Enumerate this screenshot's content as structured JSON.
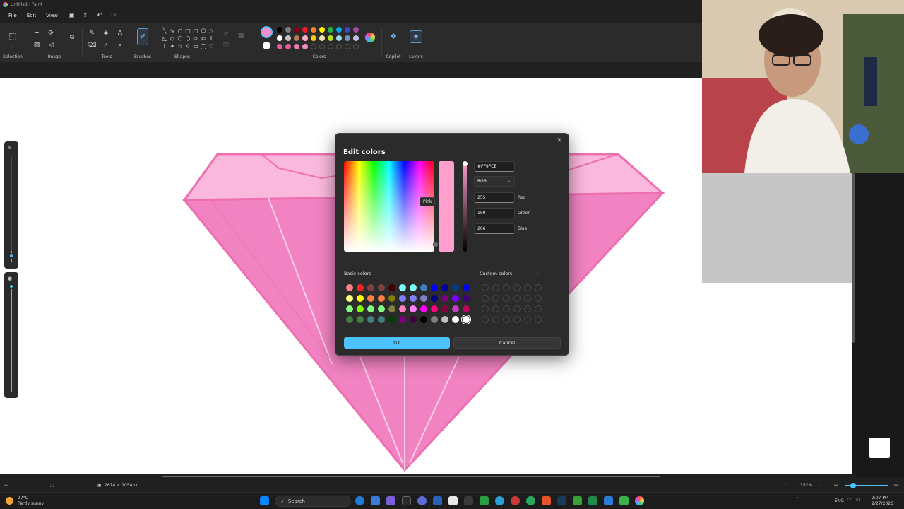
{
  "window": {
    "title": "Untitled - Paint"
  },
  "menu": {
    "file": "File",
    "edit": "Edit",
    "view": "View"
  },
  "ribbon": {
    "selection_label": "Selection",
    "image_label": "Image",
    "tools_label": "Tools",
    "brushes_label": "Brushes",
    "shapes_label": "Shapes",
    "colors_label": "Colors",
    "copilot_label": "Copilot",
    "layers_label": "Layers",
    "color1": "#F48FC8",
    "color2": "#FFFFFF",
    "palette": [
      "#000000",
      "#7f7f7f",
      "#880015",
      "#ed1c24",
      "#ff7f27",
      "#fff200",
      "#22b14c",
      "#00a2e8",
      "#3f48cc",
      "#a349a4",
      "#ffffff",
      "#c3c3c3",
      "#b97a57",
      "#ffaec9",
      "#ffc90e",
      "#efe4b0",
      "#b5e61d",
      "#99d9ea",
      "#7092be",
      "#c8bfe7",
      "#e75a9b",
      "#e75a9b",
      "#f07ab0",
      "#f090c0",
      "#ffffff",
      "#ffffff",
      "#ffffff",
      "#ffffff",
      "#ffffff",
      "#ffffff"
    ]
  },
  "dialog": {
    "title": "Edit colors",
    "tooltip": "Pink",
    "hex_value": "#FF9FCE",
    "mode": "RGB",
    "red_value": "255",
    "red_label": "Red",
    "green_value": "159",
    "green_label": "Green",
    "blue_value": "206",
    "blue_label": "Blue",
    "basic_colors_label": "Basic colors",
    "custom_colors_label": "Custom colors",
    "ok_label": "OK",
    "cancel_label": "Cancel",
    "preview_color": "#FF9FCE",
    "basic_colors": [
      "#ff8080",
      "#ff2020",
      "#804040",
      "#804040",
      "#400000",
      "#80ffff",
      "#80ffff",
      "#4080c0",
      "#0000ff",
      "#0000a0",
      "#004080",
      "#0000ff",
      "#ffff80",
      "#ffff00",
      "#ff8040",
      "#ff8040",
      "#808000",
      "#8080ff",
      "#8080ff",
      "#8080c0",
      "#000080",
      "#800080",
      "#8000ff",
      "#400080",
      "#80ff80",
      "#80ff00",
      "#80ff80",
      "#80ff80",
      "#808040",
      "#ff80c0",
      "#ff80ff",
      "#ff00ff",
      "#ff0080",
      "#800040",
      "#c040c0",
      "#c00060",
      "#408040",
      "#408040",
      "#408080",
      "#408080",
      "#004000",
      "#800080",
      "#400040",
      "#000000",
      "#808080",
      "#c0c0c0",
      "#ffffff",
      "#ffffff"
    ],
    "selected_basic": "#ffffff"
  },
  "status": {
    "canvas_size": "2614 × 1054px",
    "zoom": "152%"
  },
  "taskbar": {
    "weather_temp": "27°C",
    "weather_desc": "Partly sunny",
    "search_placeholder": "Search",
    "lang": "ENG",
    "time": "2:07 PM",
    "date": "2/27/2026"
  }
}
